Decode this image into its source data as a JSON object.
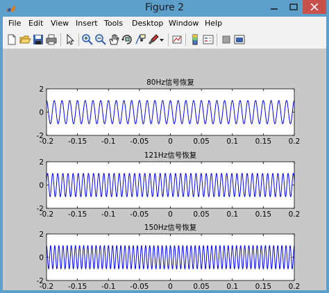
{
  "window": {
    "title": "Figure 2"
  },
  "menu": [
    "File",
    "Edit",
    "View",
    "Insert",
    "Tools",
    "Desktop",
    "Window",
    "Help"
  ],
  "toolbar": {
    "icons": [
      "new-figure-icon",
      "open-file-icon",
      "save-icon",
      "print-icon",
      "edit-plot-icon",
      "zoom-in-icon",
      "zoom-out-icon",
      "pan-icon",
      "rotate-3d-icon",
      "data-cursor-icon",
      "brush-icon",
      "brush-dropdown-icon",
      "link-plot-icon",
      "insert-colorbar-icon",
      "insert-legend-icon",
      "hide-plot-tools-icon",
      "show-plot-tools-icon"
    ]
  },
  "chart_data": [
    {
      "type": "line",
      "title": "80Hz信号恢复",
      "frequency_hz": 80,
      "amplitude": 1,
      "xlim": [
        -0.2,
        0.2
      ],
      "ylim": [
        -2,
        2
      ],
      "xticks": [
        "-0.2",
        "-0.15",
        "-0.1",
        "-0.05",
        "0",
        "0.05",
        "0.1",
        "0.15",
        "0.2"
      ],
      "yticks": [
        "-2",
        "0",
        "2"
      ],
      "color": "#0000ff"
    },
    {
      "type": "line",
      "title": "121Hz信号恢复",
      "frequency_hz": 121,
      "amplitude": 1,
      "xlim": [
        -0.2,
        0.2
      ],
      "ylim": [
        -2,
        2
      ],
      "xticks": [
        "-0.2",
        "-0.15",
        "-0.1",
        "-0.05",
        "0",
        "0.05",
        "0.1",
        "0.15",
        "0.2"
      ],
      "yticks": [
        "-2",
        "0",
        "2"
      ],
      "color": "#0000ff"
    },
    {
      "type": "line",
      "title": "150Hz信号恢复",
      "frequency_hz": 150,
      "amplitude": 1,
      "xlim": [
        -0.2,
        0.2
      ],
      "ylim": [
        -2,
        2
      ],
      "xticks": [
        "-0.2",
        "-0.15",
        "-0.1",
        "-0.05",
        "0",
        "0.05",
        "0.1",
        "0.15",
        "0.2"
      ],
      "yticks": [
        "-2",
        "0",
        "2"
      ],
      "color": "#0000ff"
    }
  ]
}
